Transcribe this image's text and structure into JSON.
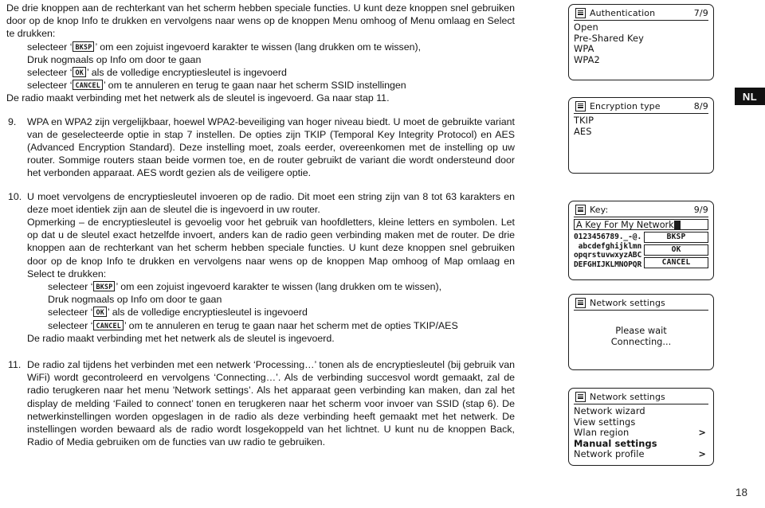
{
  "page": {
    "number": "18",
    "language_tab": "NL"
  },
  "text": {
    "intro": {
      "line1": "De drie knoppen aan de rechterkant van het scherm hebben speciale functies. U kunt deze knoppen snel gebruiken door op de knop Info te drukken en vervolgens naar wens op de knoppen Menu omhoog of Menu omlaag en Select te drukken:",
      "bullet_bksp_pre": "selecteer ‘",
      "bullet_bksp_key": "BKSP",
      "bullet_bksp_post": "’ om een zojuist ingevoerd karakter te wissen (lang drukken om te  wissen),",
      "bullet_bksp_line2": "Druk nogmaals op Info om door te gaan",
      "bullet_ok_pre": "selecteer ‘",
      "bullet_ok_key": "OK",
      "bullet_ok_post": "’ als de volledige encryptiesleutel is ingevoerd",
      "bullet_cancel_pre": "selecteer ‘",
      "bullet_cancel_key": "CANCEL",
      "bullet_cancel_post": "’ om te annuleren en terug te gaan naar het scherm SSID instellingen",
      "closing": "De radio maakt verbinding met het netwerk als de sleutel is ingevoerd. Ga naar stap 11."
    },
    "step9": {
      "number": "9.",
      "body": "WPA en WPA2 zijn vergelijkbaar, hoewel WPA2-beveiliging van hoger niveau biedt. U moet de gebruikte variant van de geselecteerde optie in stap 7 instellen. De opties zijn TKIP (Temporal Key Integrity Protocol) en AES (Advanced Encryption Standard). Deze instelling moet, zoals eerder, overeenkomen met de instelling op uw router. Sommige routers staan beide vormen toe, en de router gebruikt de variant die wordt ondersteund door het verbonden apparaat. AES wordt gezien als de veiligere optie."
    },
    "step10": {
      "number": "10.",
      "para1": "U moet vervolgens de encryptiesleutel invoeren op de radio. Dit moet een string zijn van 8 tot 63 karakters en deze moet identiek zijn aan de sleutel die is ingevoerd in uw router.",
      "para2": "Opmerking – de encryptiesleutel is gevoelig voor het gebruik van hoofdletters, kleine letters en symbolen. Let op dat u de sleutel exact hetzelfde invoert, anders kan de radio geen verbinding maken met de router. De drie knoppen aan de rechterkant van het scherm hebben speciale functies. U kunt deze knoppen snel gebruiken door op de knop Info te drukken en vervolgens naar wens op de knoppen Map omhoog of Map omlaag en Select te drukken:",
      "bullet_bksp_pre": "selecteer ‘",
      "bullet_bksp_key": "BKSP",
      "bullet_bksp_post": "’ om een zojuist ingevoerd karakter te wissen (lang drukken om te wissen),",
      "bullet_bksp_line2": "Druk nogmaals op Info om door te gaan",
      "bullet_ok_pre": "selecteer ‘",
      "bullet_ok_key": "OK",
      "bullet_ok_post": "’ als de volledige encryptiesleutel is ingevoerd",
      "bullet_cancel_pre": "selecteer ‘",
      "bullet_cancel_key": "CANCEL",
      "bullet_cancel_post": "’ om te annuleren en terug te gaan naar het scherm met de opties TKIP/AES",
      "closing": "De radio maakt verbinding met het netwerk als de sleutel is ingevoerd."
    },
    "step11": {
      "number": "11.",
      "body": "De radio zal tijdens het verbinden met een netwerk ‘Processing…’ tonen als de encryptiesleutel (bij gebruik van WiFi) wordt gecontroleerd en vervolgens ‘Connecting…’. Als de verbinding succesvol wordt gemaakt, zal de radio terugkeren naar het menu 'Network settings’. Als het apparaat geen verbinding kan maken, dan zal het display de melding ‘Failed to connect’ tonen en terugkeren naar het scherm voor invoer van SSID (stap 6). De netwerkinstellingen worden opgeslagen in de radio als deze verbinding heeft gemaakt met het netwerk. De instellingen worden bewaard als de radio wordt losgekoppeld van het lichtnet. U kunt nu de knoppen Back, Radio of Media gebruiken om de functies van uw radio te gebruiken."
    }
  },
  "panels": {
    "authentication": {
      "icon": "menu-list-icon",
      "title": "Authentication",
      "count": "7/9",
      "items": [
        "Open",
        "Pre-Shared Key",
        "WPA",
        "WPA2"
      ]
    },
    "encryption": {
      "icon": "menu-list-icon",
      "title": "Encryption type",
      "count": "8/9",
      "items": [
        "TKIP",
        "AES"
      ]
    },
    "key": {
      "icon": "menu-list-icon",
      "title": "Key:",
      "count": "9/9",
      "value": "A Key For My Network",
      "charmap": [
        "0123456789._-@.",
        " abcdefghijklmn",
        "opqrstuvwxyzABC",
        "DEFGHIJKLMNOPQR"
      ],
      "buttons": [
        "BKSP",
        "OK",
        "CANCEL"
      ]
    },
    "connecting": {
      "icon": "menu-list-icon",
      "title": "Network settings",
      "count": "",
      "line1": "Please wait",
      "line2": "Connecting..."
    },
    "network_settings": {
      "icon": "menu-list-icon",
      "title": "Network settings",
      "count": "",
      "items": [
        {
          "label": "Network wizard",
          "arrow": "",
          "bold": false
        },
        {
          "label": "View settings",
          "arrow": "",
          "bold": false
        },
        {
          "label": "Wlan region",
          "arrow": ">",
          "bold": false
        },
        {
          "label": "Manual settings",
          "arrow": "",
          "bold": true
        },
        {
          "label": "Network profile",
          "arrow": ">",
          "bold": false
        }
      ]
    }
  },
  "colors": {
    "ink": "#141414",
    "tab_bg": "#111111",
    "tab_fg": "#ffffff",
    "panel_border": "#1d1d1d"
  }
}
